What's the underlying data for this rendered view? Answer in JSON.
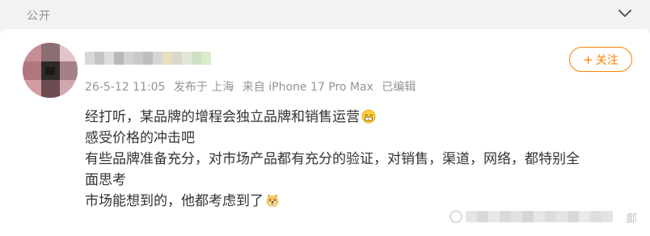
{
  "header": {
    "visibility": "公开",
    "collapse_icon": "chevron-down-icon"
  },
  "post": {
    "username": "",
    "meta": {
      "date": "26-5-12 11:05",
      "location": "发布于 上海",
      "device": "来自 iPhone 17 Pro Max",
      "edited": "已编辑"
    },
    "follow_label": "关注",
    "lines": [
      "经打听，某品牌的增程会独立品牌和销售运营",
      "感受价格的冲击吧",
      "有些品牌准备充分，对市场产品都有充分的验证，对销售，渠道，网络，都特别全",
      "面思考",
      "市场能想到的，他都考虑到了"
    ],
    "emojis": [
      "grin-emoji",
      "doge-emoji"
    ]
  },
  "watermark": {
    "tail": "䣜"
  },
  "colors": {
    "accent": "#ff8200",
    "text": "#333333",
    "meta": "#939393",
    "background": "#f2f2f2"
  }
}
